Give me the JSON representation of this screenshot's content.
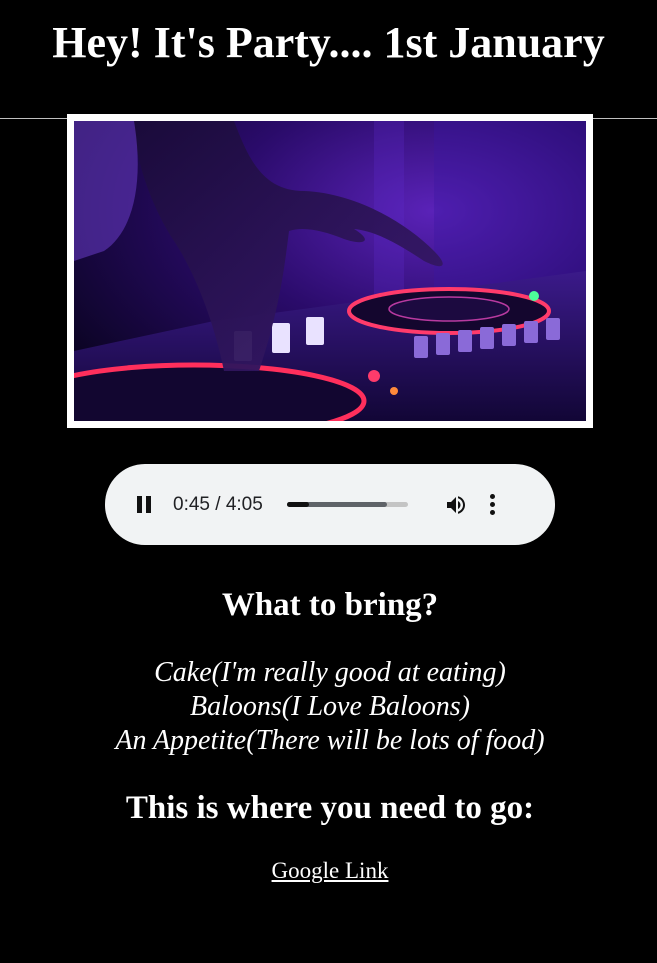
{
  "header": {
    "title": "Hey! It's Party.... 1st January"
  },
  "hero_image": {
    "icon": "dj-turntable-image",
    "colors": {
      "frame": "#ffffff",
      "accent_purple": "#6a1fd6",
      "accent_pink": "#ff3b6b"
    }
  },
  "audio_player": {
    "current_time": "0:45",
    "duration": "4:05",
    "time_display": "0:45 / 4:05",
    "progress": 0.18,
    "buffered": 0.83,
    "play_state_icon": "pause-icon",
    "volume_icon": "volume-icon",
    "menu_icon": "more-vert-icon"
  },
  "bring": {
    "heading": "What to bring?",
    "items": [
      "Cake(I'm really good at eating)",
      "Baloons(I Love Baloons)",
      "An Appetite(There will be lots of food)"
    ]
  },
  "location": {
    "heading": "This is where you need to go:",
    "link_text": "Google Link"
  }
}
